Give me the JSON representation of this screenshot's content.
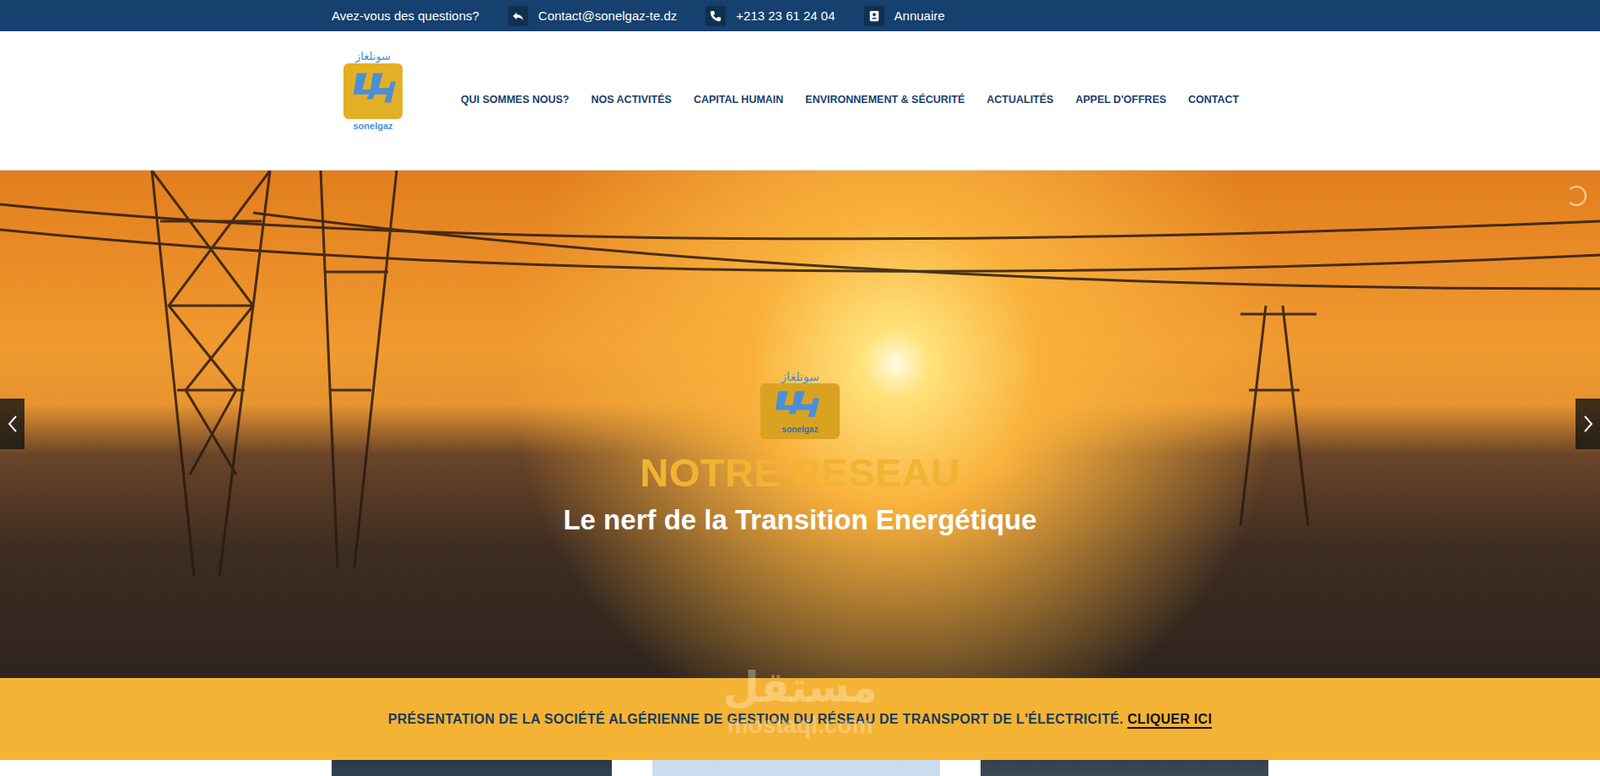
{
  "top_bar": {
    "question": "Avez-vous des questions?",
    "items": [
      {
        "label": "Contact@sonelgaz-te.dz",
        "kind": "email"
      },
      {
        "label": "+213 23 61 24 04",
        "kind": "phone"
      },
      {
        "label": "Annuaire",
        "kind": "directory"
      }
    ]
  },
  "header": {
    "logo": {
      "arabic": "سونلغاز",
      "latin": "sonelgaz"
    },
    "nav": [
      "QUI SOMMES NOUS?",
      "NOS ACTIVITÉS",
      "CAPITAL HUMAIN",
      "ENVIRONNEMENT & SÉCURITÉ",
      "ACTUALITÉS",
      "APPEL D'OFFRES",
      "CONTACT"
    ]
  },
  "hero": {
    "logo": {
      "arabic": "سونلغاز",
      "latin": "sonelgaz"
    },
    "title": "NOTRE RESEAU",
    "subtitle": "Le nerf de la Transition Energétique"
  },
  "band": {
    "text": "PRÉSENTATION DE LA SOCIÉTÉ ALGÉRIENNE DE GESTION DU RÉSEAU DE TRANSPORT DE L'ÉLECTRICITÉ.",
    "link": "CLIQUER ICI"
  },
  "watermark": {
    "arabic": "مستقل",
    "latin": "mostaql.com"
  }
}
